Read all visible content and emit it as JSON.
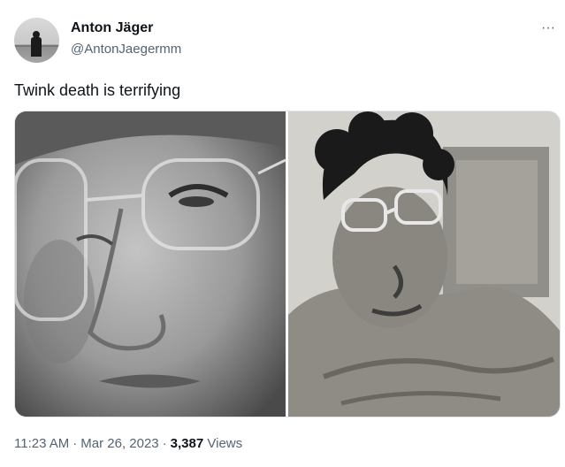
{
  "author": {
    "name": "Anton Jäger",
    "handle": "@AntonJaegermm"
  },
  "tweet": {
    "text": "Twink death is terrifying"
  },
  "menu": {
    "more_icon": "more-horizontal-icon",
    "more_glyph": "···"
  },
  "media": {
    "photos": [
      "photo-left",
      "photo-right"
    ]
  },
  "meta": {
    "time": "11:23 AM",
    "separator": "·",
    "date": "Mar 26, 2023",
    "views_count": "3,387",
    "views_label": "Views"
  }
}
